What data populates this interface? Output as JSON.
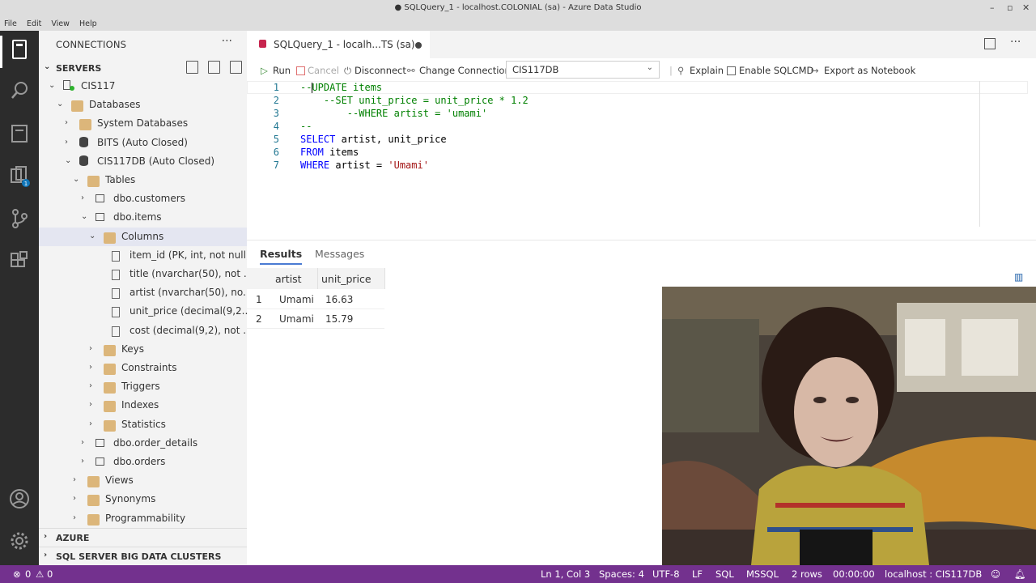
{
  "window": {
    "title": "● SQLQuery_1 - localhost.COLONIAL (sa) - Azure Data Studio"
  },
  "menu": [
    "File",
    "Edit",
    "View",
    "Help"
  ],
  "sidebar": {
    "title": "CONNECTIONS",
    "servers_label": "SERVERS",
    "tree": [
      {
        "label": "CIS117",
        "icon": "server-icon"
      },
      {
        "label": "Databases",
        "icon": "folder-icon"
      },
      {
        "label": "System Databases",
        "icon": "folder-icon"
      },
      {
        "label": "BITS (Auto Closed)",
        "icon": "database-icon"
      },
      {
        "label": "CIS117DB (Auto Closed)",
        "icon": "database-icon"
      },
      {
        "label": "Tables",
        "icon": "folder-icon"
      },
      {
        "label": "dbo.customers",
        "icon": "table-icon"
      },
      {
        "label": "dbo.items",
        "icon": "table-icon"
      },
      {
        "label": "Columns",
        "icon": "folder-icon"
      },
      {
        "label": "item_id (PK, int, not null)",
        "icon": "column-icon"
      },
      {
        "label": "title (nvarchar(50), not ...",
        "icon": "column-icon"
      },
      {
        "label": "artist (nvarchar(50), no...",
        "icon": "column-icon"
      },
      {
        "label": "unit_price (decimal(9,2...",
        "icon": "column-icon"
      },
      {
        "label": "cost (decimal(9,2), not ...",
        "icon": "column-icon"
      },
      {
        "label": "Keys",
        "icon": "folder-icon"
      },
      {
        "label": "Constraints",
        "icon": "folder-icon"
      },
      {
        "label": "Triggers",
        "icon": "folder-icon"
      },
      {
        "label": "Indexes",
        "icon": "folder-icon"
      },
      {
        "label": "Statistics",
        "icon": "folder-icon"
      },
      {
        "label": "dbo.order_details",
        "icon": "table-icon"
      },
      {
        "label": "dbo.orders",
        "icon": "table-icon"
      },
      {
        "label": "Views",
        "icon": "folder-icon"
      },
      {
        "label": "Synonyms",
        "icon": "folder-icon"
      },
      {
        "label": "Programmability",
        "icon": "folder-icon"
      }
    ],
    "azure_label": "AZURE",
    "bigdata_label": "SQL SERVER BIG DATA CLUSTERS"
  },
  "editor": {
    "tab_label": "SQLQuery_1 - localh...TS (sa)",
    "toolbar": {
      "run": "Run",
      "cancel": "Cancel",
      "disconnect": "Disconnect",
      "change_connection": "Change Connection",
      "database": "CIS117DB",
      "explain": "Explain",
      "sqlcmd": "Enable SQLCMD",
      "export": "Export as Notebook"
    },
    "lines": [
      {
        "num": "1",
        "text": "--UPDATE items"
      },
      {
        "num": "2",
        "text": "    --SET unit_price = unit_price * 1.2"
      },
      {
        "num": "3",
        "text": "        --WHERE artist = 'umami'"
      },
      {
        "num": "4",
        "text": "--"
      },
      {
        "num": "5",
        "kw": "SELECT",
        "rest": " artist, unit_price"
      },
      {
        "num": "6",
        "kw": "FROM",
        "rest": " items"
      },
      {
        "num": "7",
        "kw": "WHERE",
        "rest": " artist = ",
        "str": "'Umami'"
      }
    ]
  },
  "results": {
    "tabs": [
      "Results",
      "Messages"
    ],
    "columns": [
      "artist",
      "unit_price"
    ],
    "rows": [
      {
        "n": "1",
        "artist": "Umami",
        "unit_price": "16.63"
      },
      {
        "n": "2",
        "artist": "Umami",
        "unit_price": "15.79"
      }
    ]
  },
  "statusbar": {
    "errors": "0",
    "warnings": "0",
    "position": "Ln 1, Col 3",
    "spaces": "Spaces: 4",
    "encoding": "UTF-8",
    "eol": "LF",
    "language": "SQL",
    "flavor": "MSSQL",
    "rows": "2 rows",
    "time": "00:00:00",
    "connection": "localhost : CIS117DB"
  },
  "colors": {
    "statusbar": "#73318e",
    "activitybar": "#2c2c2c",
    "comment": "#008000",
    "keyword": "#0000ff",
    "string": "#a31515"
  }
}
